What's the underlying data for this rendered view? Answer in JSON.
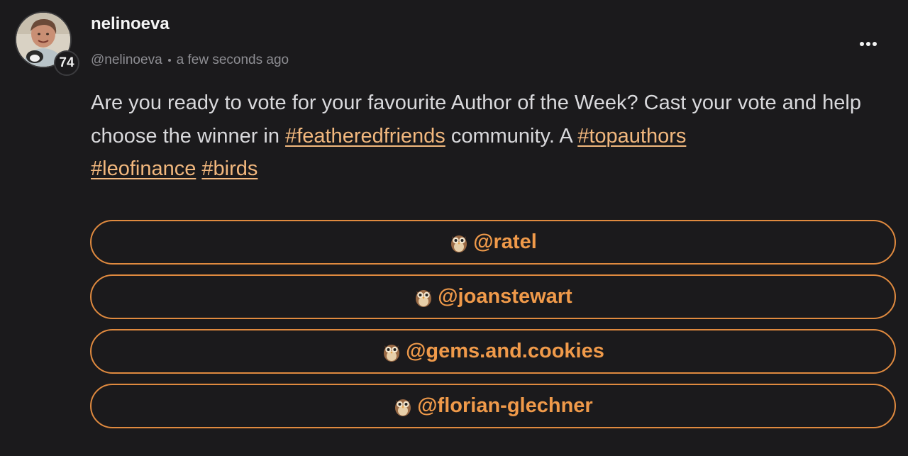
{
  "author": {
    "display_name": "nelinoeva",
    "handle": "@nelinoeva",
    "reputation": "74",
    "timestamp": "a few seconds ago"
  },
  "post": {
    "text_1": "Are you ready to vote for your favourite Author of the Week? Cast your vote and help choose the winner in ",
    "tag_1": "#featheredfriends",
    "text_2": " community. A ",
    "tag_2": "#topauthors",
    "tag_3": "#leofinance",
    "tag_4": "#birds"
  },
  "poll": {
    "option_icon": "owl-icon",
    "options": [
      {
        "label": "@ratel"
      },
      {
        "label": "@joanstewart"
      },
      {
        "label": "@gems.and.cookies"
      },
      {
        "label": "@florian-glechner"
      }
    ]
  },
  "colors": {
    "background": "#1b1a1c",
    "accent": "#f09a4a",
    "hashtag": "#f2b87e"
  }
}
